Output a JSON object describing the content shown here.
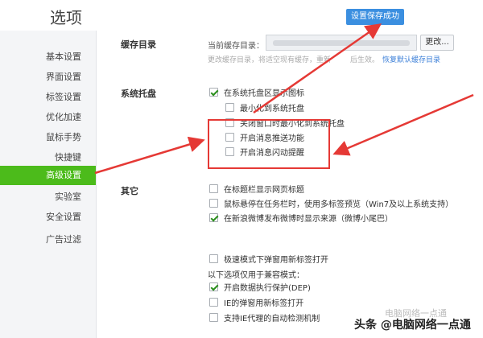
{
  "header": {
    "title": "选项",
    "save_success": "设置保存成功"
  },
  "sidebar": {
    "items": [
      {
        "label": "基本设置"
      },
      {
        "label": "界面设置"
      },
      {
        "label": "标签设置"
      },
      {
        "label": "优化加速"
      },
      {
        "label": "鼠标手势"
      },
      {
        "label": "快捷键"
      },
      {
        "label": "高级设置",
        "active": true
      },
      {
        "label": "实验室"
      },
      {
        "label": "安全设置"
      },
      {
        "label": "广告过滤"
      }
    ]
  },
  "cache": {
    "section": "缓存目录",
    "label": "当前缓存目录：",
    "path": "",
    "change": "更改...",
    "hint": "更改缓存目录，将适空现有缓存，重新",
    "hint_tail": "后生效。",
    "restore": "恢复默认缓存目录"
  },
  "tray": {
    "section": "系统托盘",
    "options": [
      {
        "label": "在系统托盘区显示图标",
        "checked": true
      },
      {
        "label": "最小化到系统托盘",
        "checked": false
      },
      {
        "label": "关闭窗口时最小化到系统托盘",
        "checked": false
      },
      {
        "label": "开启消息推送功能",
        "checked": false
      },
      {
        "label": "开启消息闪动提醒",
        "checked": false
      }
    ]
  },
  "other": {
    "section": "其它",
    "options": [
      {
        "label": "在标题栏显示网页标题",
        "checked": false
      },
      {
        "label": "鼠标悬停在任务栏时，使用多标签预览（Win7及以上系统支持）",
        "checked": false
      },
      {
        "label": "在新浪微博发布微博时显示来源（微博小尾巴）",
        "checked": true
      },
      {
        "label": "极速模式下弹窗用新标签打开",
        "checked": false
      }
    ],
    "compat_note": "以下选项仅用于兼容模式：",
    "compat_options": [
      {
        "label": "开启数据执行保护(DEP)",
        "checked": true
      },
      {
        "label": "IE的弹窗用新标签打开",
        "checked": false
      },
      {
        "label": "支持IE代理的自动检测机制",
        "checked": false
      }
    ]
  },
  "watermark": {
    "text": "头条 @电脑网络一点通",
    "faint": "电脑网络一点通"
  },
  "colors": {
    "accent_green": "#4cbb1b",
    "save_blue": "#3b8fe0",
    "annotation_red": "#e53935"
  }
}
